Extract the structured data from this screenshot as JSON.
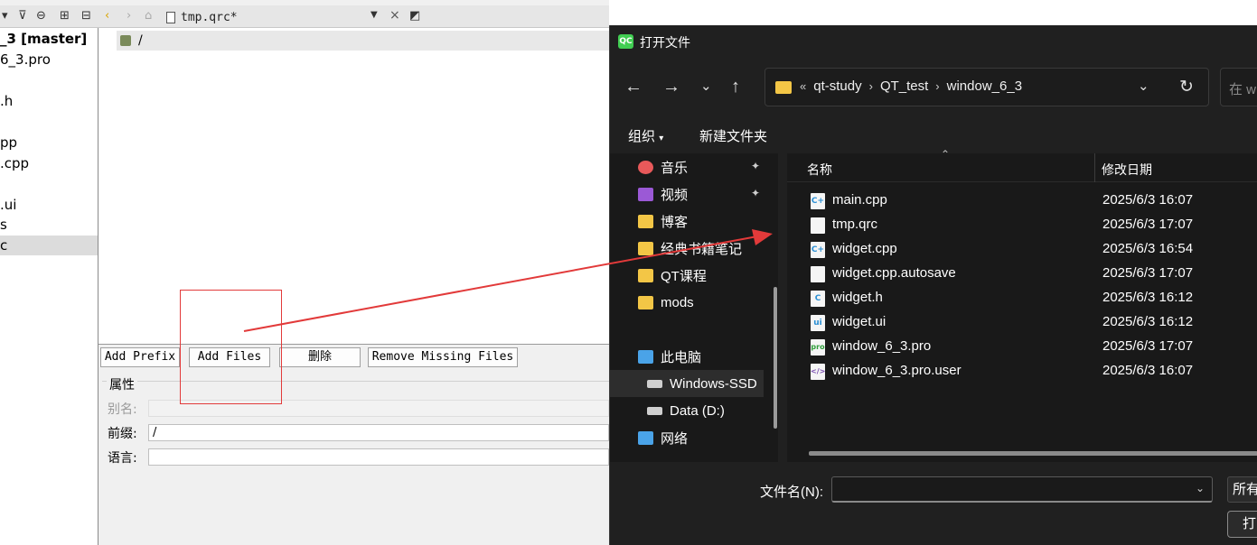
{
  "qt": {
    "open_file_tab": "tmp.qrc*",
    "project_items": [
      {
        "label": "_3 [master]",
        "bold": true
      },
      {
        "label": "6_3.pro"
      },
      {
        "label": ".h"
      },
      {
        "label": "pp"
      },
      {
        "label": ".cpp"
      },
      {
        "label": ".ui"
      },
      {
        "label": "s"
      },
      {
        "label": "c",
        "selected": true
      }
    ],
    "prefix": "/",
    "buttons": {
      "add_prefix": "Add Prefix",
      "add_files": "Add Files",
      "delete": "删除",
      "remove_missing": "Remove Missing Files"
    },
    "properties": {
      "title": "属性",
      "alias_label": "别名:",
      "prefix_label": "前缀:",
      "prefix_value": "/",
      "language_label": "语言:"
    }
  },
  "dialog": {
    "title": "打开文件",
    "breadcrumbs": [
      "qt-study",
      "QT_test",
      "window_6_3"
    ],
    "search_placeholder": "在 w",
    "commands": {
      "organize": "组织",
      "new_folder": "新建文件夹"
    },
    "nav_items": [
      {
        "label": "音乐",
        "icon": "music-icon",
        "color": "#e8595a",
        "pinned": true
      },
      {
        "label": "视频",
        "icon": "video-icon",
        "color": "#9b59d6",
        "pinned": true
      },
      {
        "label": "博客",
        "icon": "folder-icon",
        "color": "#f3c646"
      },
      {
        "label": "经典书籍笔记",
        "icon": "folder-icon",
        "color": "#f3c646"
      },
      {
        "label": "QT课程",
        "icon": "folder-icon",
        "color": "#f3c646"
      },
      {
        "label": "mods",
        "icon": "folder-icon",
        "color": "#f3c646"
      },
      {
        "label": "此电脑",
        "icon": "computer-icon",
        "color": "#4aa3e8"
      },
      {
        "label": "Windows-SSD",
        "icon": "drive-icon",
        "color": "#cfcfcf",
        "selected": true,
        "indent": true
      },
      {
        "label": "Data (D:)",
        "icon": "drive-icon",
        "color": "#cfcfcf",
        "indent": true
      },
      {
        "label": "网络",
        "icon": "network-icon",
        "color": "#4aa3e8"
      }
    ],
    "columns": {
      "name": "名称",
      "modified": "修改日期"
    },
    "files": [
      {
        "name": "main.cpp",
        "date": "2025/6/3 16:07",
        "icon": "cpp-file-icon",
        "badge": "C+",
        "badge_color": "#2a8fd4"
      },
      {
        "name": "tmp.qrc",
        "date": "2025/6/3 17:07",
        "icon": "generic-file-icon",
        "badge": "",
        "badge_color": "#f5f5f5"
      },
      {
        "name": "widget.cpp",
        "date": "2025/6/3 16:54",
        "icon": "cpp-file-icon",
        "badge": "C+",
        "badge_color": "#2a8fd4"
      },
      {
        "name": "widget.cpp.autosave",
        "date": "2025/6/3 17:07",
        "icon": "generic-file-icon",
        "badge": "",
        "badge_color": "#f5f5f5"
      },
      {
        "name": "widget.h",
        "date": "2025/6/3 16:12",
        "icon": "header-file-icon",
        "badge": "C",
        "badge_color": "#2a8fd4"
      },
      {
        "name": "widget.ui",
        "date": "2025/6/3 16:12",
        "icon": "ui-file-icon",
        "badge": "ui",
        "badge_color": "#2a8fd4"
      },
      {
        "name": "window_6_3.pro",
        "date": "2025/6/3 17:07",
        "icon": "pro-file-icon",
        "badge": "pro",
        "badge_color": "#41cd52"
      },
      {
        "name": "window_6_3.pro.user",
        "date": "2025/6/3 16:07",
        "icon": "user-file-icon",
        "badge": "</>",
        "badge_color": "#7a4fb0"
      }
    ],
    "filename_label": "文件名(N):",
    "filename_value": "",
    "filter_label": "所有",
    "open_label": "打"
  }
}
